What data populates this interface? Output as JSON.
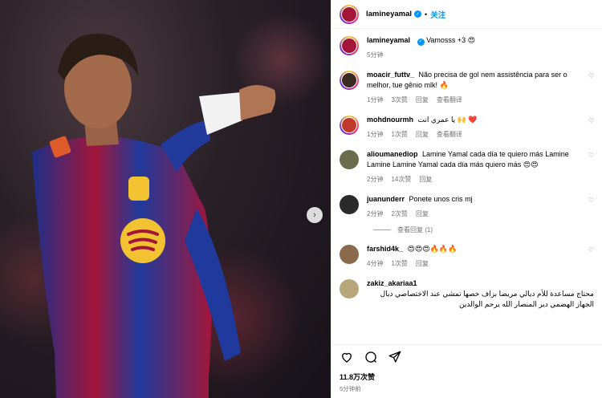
{
  "post": {
    "author": "lamineyamal",
    "follow_label": "关注",
    "caption": "Vamosss +3 😍",
    "caption_time": "5分钟",
    "likes": "11.8万次赞",
    "posted": "5分钟前"
  },
  "comments": [
    {
      "user": "moacir_futtv_",
      "text": "Não precisa de gol nem assistência para ser o melhor, tue gênio mlk! 🔥",
      "time": "1分钟",
      "likes": "3次赞",
      "reply": "回复",
      "translate": "查看翻译",
      "avatar_color": "#3a2a22"
    },
    {
      "user": "mohdnourmh",
      "text": "يا عمري انت 🙌 ❤️",
      "time": "1分钟",
      "likes": "1次赞",
      "reply": "回复",
      "translate": "查看翻译",
      "avatar_color": "#c0392b"
    },
    {
      "user": "alioumanediop",
      "text": "Lamine Yamal cada día te quiero más Lamine Lamine Lamine Yamal cada día más quiero más 😍😍",
      "time": "2分钟",
      "likes": "14次赞",
      "reply": "回复",
      "avatar_color": "#6b6b4e"
    },
    {
      "user": "juanunderr",
      "text": "Ponete unos cris mj",
      "time": "2分钟",
      "likes": "2次赞",
      "reply": "回复",
      "view_replies": "查看回复 (1)",
      "avatar_color": "#2b2b2b"
    },
    {
      "user": "farshid4k_",
      "text": "😍😍😍🔥🔥🔥",
      "time": "4分钟",
      "likes": "1次赞",
      "reply": "回复",
      "avatar_color": "#8a6a4a"
    },
    {
      "user": "zakiz_akariaa1",
      "text": "محتاج مساعدة للأم ديالي مريضا بزاف خصها تمشي عند الاختصاصي ديال الجهاز الهضمي دير المنصار الله يرحم الوالدين",
      "avatar_color": "#b8a77a"
    }
  ],
  "accent_color": "#0095f6",
  "icons": [
    "heart-icon",
    "comment-icon",
    "share-icon",
    "chevron-right-icon",
    "verified-icon"
  ]
}
